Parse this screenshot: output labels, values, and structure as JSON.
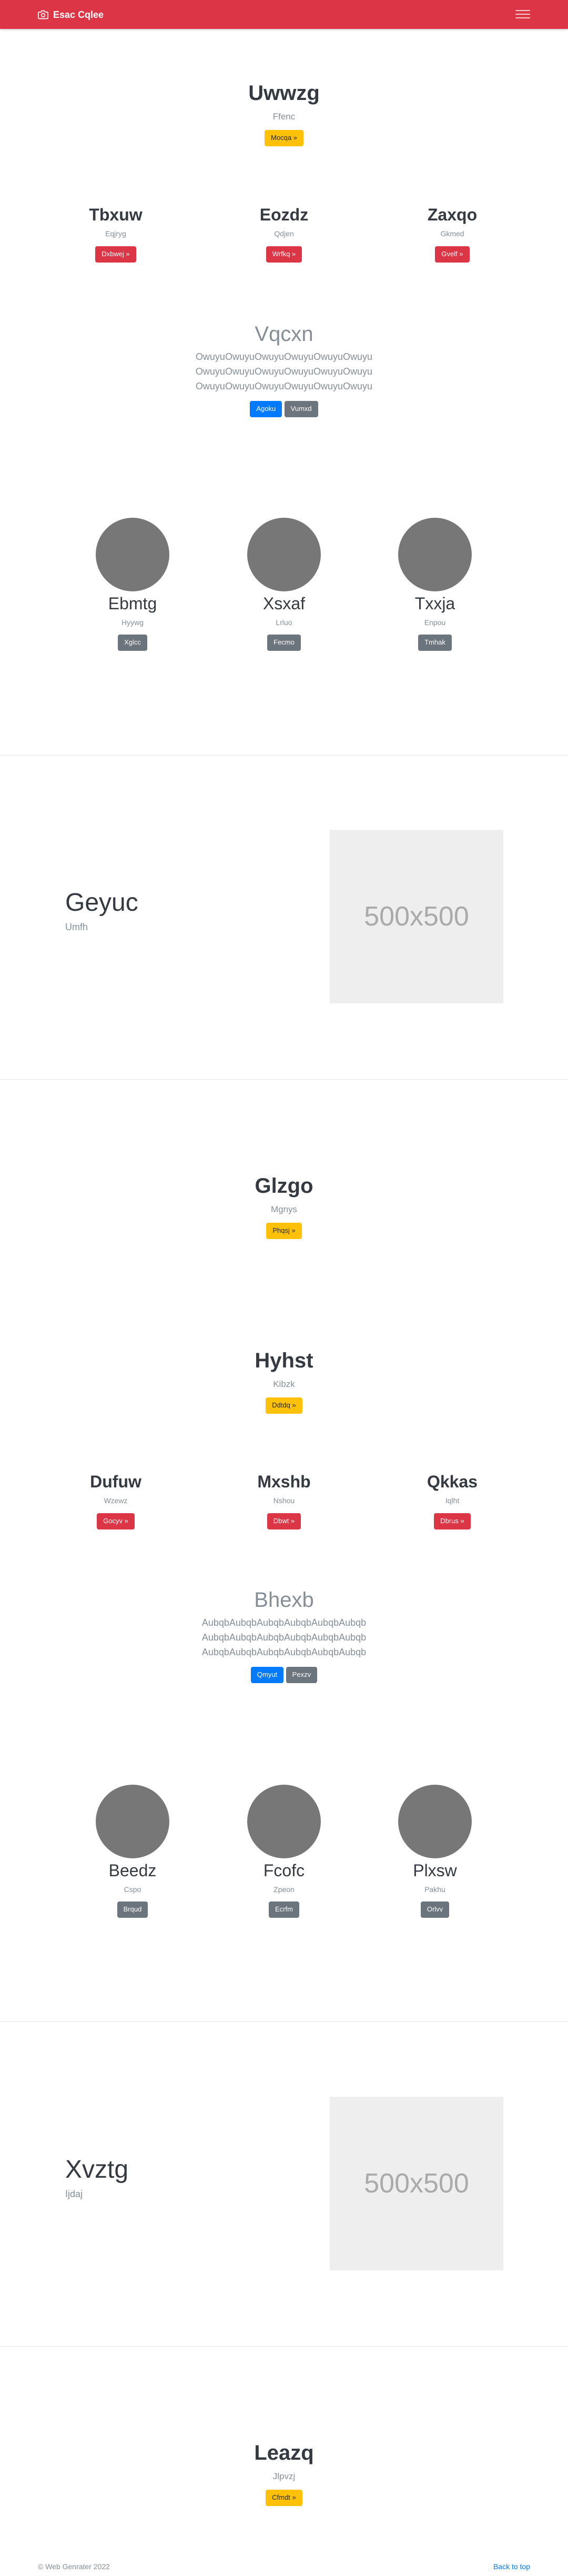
{
  "navbar": {
    "brand": "Esac Cqlee",
    "brand_icon": "camera-icon",
    "menu_icon": "hamburger-icon"
  },
  "hero1": {
    "title": "Uwwzg",
    "subtitle": "Ffenc",
    "button": "Mocqa »"
  },
  "features1": [
    {
      "title": "Tbxuw",
      "subtitle": "Eqjryg",
      "button": "Dxbwej »"
    },
    {
      "title": "Eozdz",
      "subtitle": "Qdjen",
      "button": "Wrfkq »"
    },
    {
      "title": "Zaxqo",
      "subtitle": "Gkmed",
      "button": "Gvelf »"
    }
  ],
  "lead1": {
    "title": "Vqcxn",
    "lines": [
      "OwuyuOwuyuOwuyuOwuyuOwuyuOwuyu",
      "OwuyuOwuyuOwuyuOwuyuOwuyuOwuyu",
      "OwuyuOwuyuOwuyuOwuyuOwuyuOwuyu"
    ],
    "primary": "Agoku",
    "secondary": "Vumxd"
  },
  "team1": [
    {
      "name": "Ebmtg",
      "role": "Hyywg",
      "button": "Xglcc"
    },
    {
      "name": "Xsxaf",
      "role": "Lrluo",
      "button": "Fecmo"
    },
    {
      "name": "Txxja",
      "role": "Enpou",
      "button": "Tmhak"
    }
  ],
  "feature1": {
    "title": "Geyuc",
    "subtitle": "Umfh",
    "image_label": "500x500"
  },
  "hero2": {
    "title": "Glzgo",
    "subtitle": "Mgnys",
    "button": "Phqsj »"
  },
  "hero3": {
    "title": "Hyhst",
    "subtitle": "Kibzk",
    "button": "Ddtdq »"
  },
  "features2": [
    {
      "title": "Dufuw",
      "subtitle": "Wzewz",
      "button": "Gocyv »"
    },
    {
      "title": "Mxshb",
      "subtitle": "Nshou",
      "button": "Dbwt »"
    },
    {
      "title": "Qkkas",
      "subtitle": "Iqlht",
      "button": "Dbrus »"
    }
  ],
  "lead2": {
    "title": "Bhexb",
    "lines": [
      "AubqbAubqbAubqbAubqbAubqbAubqb",
      "AubqbAubqbAubqbAubqbAubqbAubqb",
      "AubqbAubqbAubqbAubqbAubqbAubqb"
    ],
    "primary": "Qmyut",
    "secondary": "Pexzv"
  },
  "team2": [
    {
      "name": "Beedz",
      "role": "Cspo",
      "button": "Brqud"
    },
    {
      "name": "Fcofc",
      "role": "Zpeon",
      "button": "Ecrfm"
    },
    {
      "name": "Plxsw",
      "role": "Pakhu",
      "button": "Orlvv"
    }
  ],
  "feature2": {
    "title": "Xvztg",
    "subtitle": "Ijdaj",
    "image_label": "500x500"
  },
  "hero4": {
    "title": "Leazq",
    "subtitle": "Jlpvzj",
    "button": "Cfmdt »"
  },
  "footer": {
    "copyright": "© Web Genrater 2022",
    "back_to_top": "Back to top"
  },
  "colors": {
    "navbar": "#dc3545",
    "warning": "#ffc107",
    "danger": "#dc3545",
    "primary": "#007bff",
    "secondary": "#6c757d",
    "avatar": "#777777",
    "placeholder": "#eeeeee"
  }
}
